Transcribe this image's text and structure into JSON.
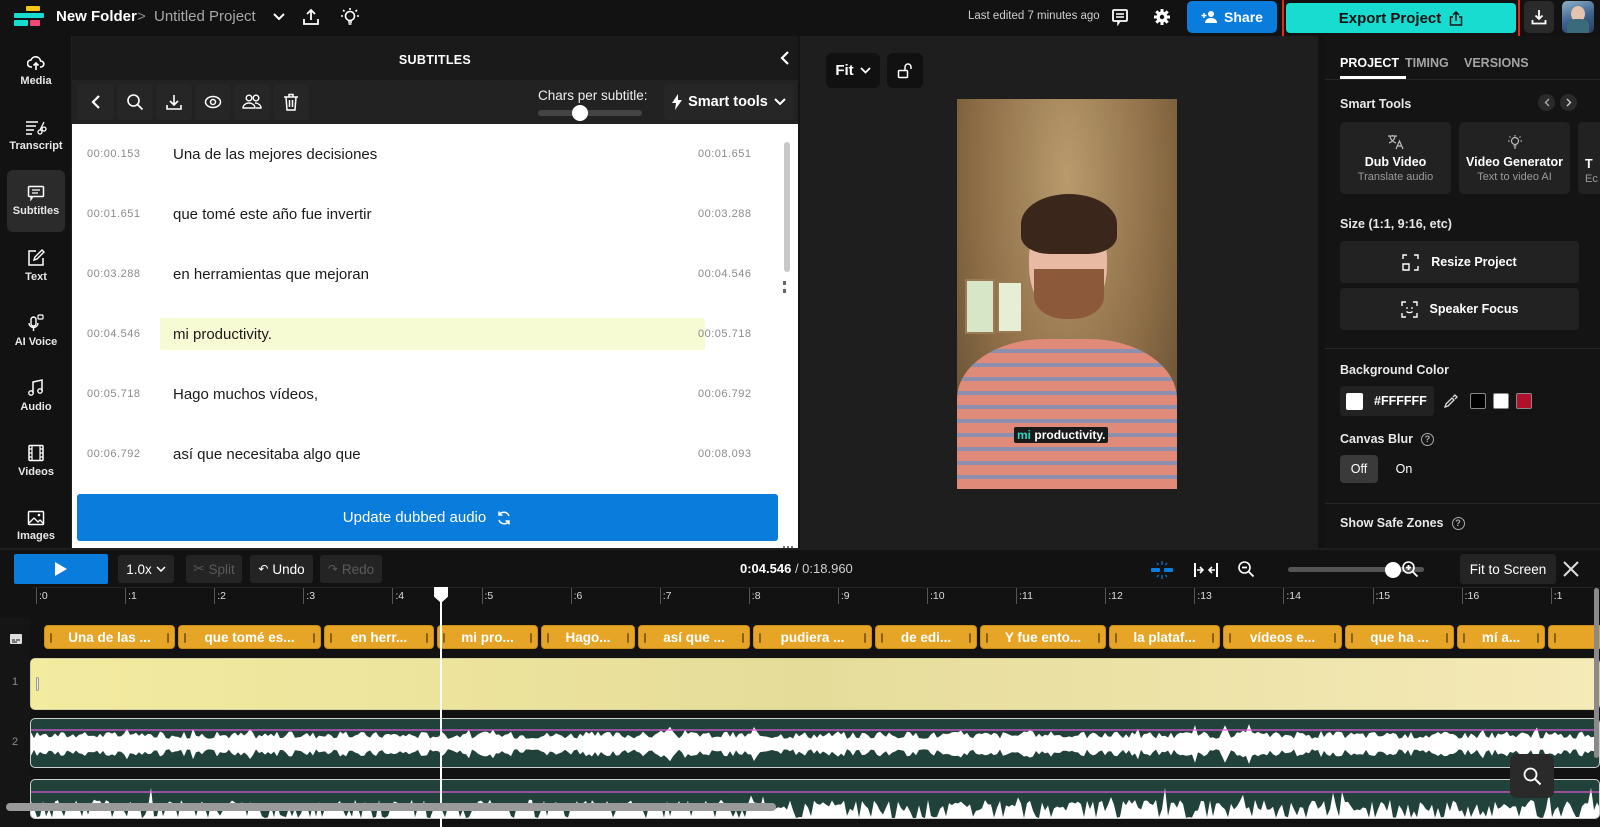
{
  "topbar": {
    "folder": "New Folder",
    "separator": ">",
    "project": "Untitled Project",
    "last_edited": "Last edited 7 minutes ago",
    "share_label": "Share",
    "export_label": "Export Project"
  },
  "leftnav": {
    "items": [
      {
        "label": "Media",
        "icon": "upload-cloud-icon"
      },
      {
        "label": "Transcript",
        "icon": "transcript-scissors-icon"
      },
      {
        "label": "Subtitles",
        "icon": "subtitles-icon",
        "active": true
      },
      {
        "label": "Text",
        "icon": "text-edit-icon"
      },
      {
        "label": "AI Voice",
        "icon": "ai-voice-mic-icon"
      },
      {
        "label": "Audio",
        "icon": "music-note-icon"
      },
      {
        "label": "Videos",
        "icon": "film-icon"
      },
      {
        "label": "Images",
        "icon": "image-icon"
      }
    ]
  },
  "subtitles": {
    "title": "SUBTITLES",
    "chars_label": "Chars per subtitle:",
    "chars_value_fraction": 0.4,
    "smart_tools_label": "Smart tools",
    "rows": [
      {
        "start": "00:00.153",
        "text": "Una de las mejores decisiones",
        "end": "00:01.651"
      },
      {
        "start": "00:01.651",
        "text": "que tomé este año fue invertir",
        "end": "00:03.288"
      },
      {
        "start": "00:03.288",
        "text": "en herramientas que mejoran",
        "end": "00:04.546"
      },
      {
        "start": "00:04.546",
        "text": "mi productivity.",
        "end": "00:05.718",
        "highlighted": true
      },
      {
        "start": "00:05.718",
        "text": "Hago muchos vídeos,",
        "end": "00:06.792"
      },
      {
        "start": "00:06.792",
        "text": "así que necesitaba algo que",
        "end": "00:08.093"
      }
    ],
    "update_button": "Update dubbed audio"
  },
  "preview": {
    "fit_label": "Fit",
    "caption_highlight": "mi",
    "caption_rest": "productivity."
  },
  "rightpanel": {
    "tabs": [
      "PROJECT",
      "TIMING",
      "VERSIONS"
    ],
    "active_tab": "PROJECT",
    "smart_tools_label": "Smart Tools",
    "tool_cards": [
      {
        "title": "Dub Video",
        "subtitle": "Translate audio",
        "icon": "translate-icon"
      },
      {
        "title": "Video Generator",
        "subtitle": "Text to video AI",
        "icon": "lightbulb-icon"
      },
      {
        "title": "T",
        "subtitle": "Ec",
        "icon": ""
      }
    ],
    "size_label": "Size (1:1, 9:16, etc)",
    "resize_label": "Resize Project",
    "speaker_focus_label": "Speaker Focus",
    "bg_color_label": "Background Color",
    "bg_color_value": "#FFFFFF",
    "swatches": [
      "#000000",
      "#FFFFFF",
      "#B0102A"
    ],
    "canvas_blur_label": "Canvas Blur",
    "blur_off": "Off",
    "blur_on": "On",
    "blur_state": "Off",
    "safe_zones_label": "Show Safe Zones"
  },
  "timeline": {
    "speed": "1.0x",
    "split": "Split",
    "undo": "Undo",
    "redo": "Redo",
    "current_time": "0:04.546",
    "total_time": "/ 0:18.960",
    "zoom_fraction": 0.77,
    "fit_to_screen": "Fit to Screen",
    "ticks": [
      ":0",
      ":1",
      ":2",
      ":3",
      ":4",
      ":5",
      ":6",
      ":7",
      ":8",
      ":9",
      ":10",
      ":11",
      ":12",
      ":13",
      ":14",
      ":15",
      ":16",
      ":1"
    ],
    "subtitle_clips": [
      "Una de las ...",
      "que tomé es...",
      "en herr...",
      "mi pro...",
      "Hago...",
      "así que ...",
      "pudiera ...",
      "de edi...",
      "Y fue ento...",
      "la plataf...",
      "vídeos e...",
      "que ha ...",
      "mí a..."
    ],
    "track_numbers": [
      "1",
      "2"
    ],
    "playhead_seconds": 4.546
  },
  "colors": {
    "accent_blue": "#0A7CDC",
    "export_teal": "#17DCCF",
    "highlight_red": "#E02B1C",
    "clip_orange": "#E6A527",
    "caption_highlight": "#2BD6C4"
  }
}
